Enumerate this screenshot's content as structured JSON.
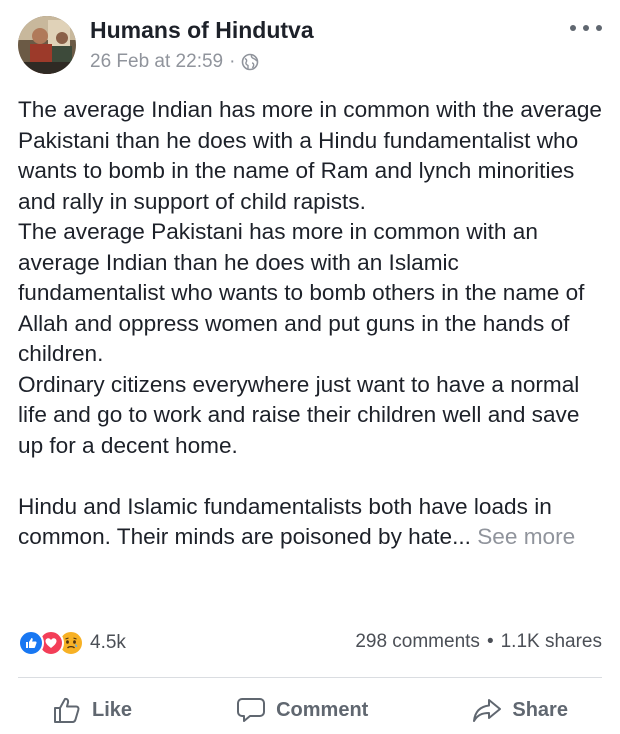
{
  "header": {
    "page_name": "Humans of Hindutva",
    "timestamp": "26 Feb at 22:59",
    "separator": "·",
    "privacy_icon": "globe-icon",
    "more_icon": "more-options-icon"
  },
  "post": {
    "paragraphs": [
      "The average Indian has more in common with the average Pakistani than he does with a Hindu fundamentalist who wants to bomb in the name of Ram and lynch minorities and rally in support of child rapists.",
      "The average Pakistani has more in common with an average Indian than he does with an Islamic fundamentalist who wants to bomb others in the name of Allah and oppress women and put guns in the hands of children.",
      "Ordinary citizens everywhere just want to have a normal life and go to work and raise their children well and save up for a decent home.",
      "Hindu and Islamic fundamentalists both have loads in common. Their minds are poisoned by hate..."
    ],
    "see_more": "See more"
  },
  "reactions": {
    "icons": [
      "like-reaction-icon",
      "love-reaction-icon",
      "sad-reaction-icon"
    ],
    "count": "4.5k"
  },
  "stats": {
    "comments": "298 comments",
    "separator": "•",
    "shares": "1.1K shares"
  },
  "actions": {
    "like_label": "Like",
    "comment_label": "Comment",
    "share_label": "Share"
  },
  "colors": {
    "like_blue": "#1877f2",
    "love_red": "#f33e58",
    "sad_yellow": "#f7b125",
    "secondary_text": "#90949c",
    "action_gray": "#606770"
  }
}
